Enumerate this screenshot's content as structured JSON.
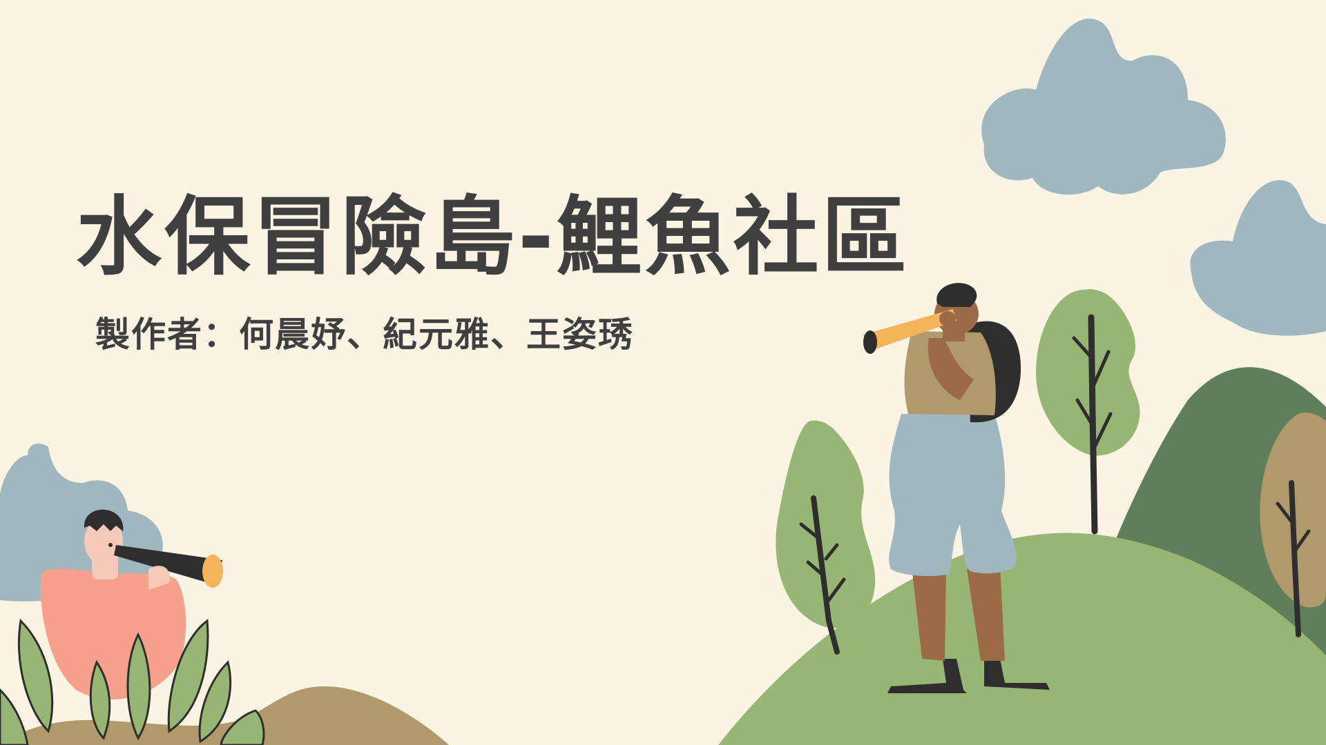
{
  "slide": {
    "title": "水保冒險島-鯉魚社區",
    "author_line": "製作者：何晨妤、紀元雅、王姿琇"
  },
  "colors": {
    "background": "#fbf4e4",
    "text": "#3f3f3f",
    "cloud": "#9fb7bf",
    "hill_light": "#98b673",
    "hill_dark": "#5f7f5a",
    "earth": "#b09a6c",
    "shirt_pink": "#f7a08c",
    "telescope_yellow": "#f4b45a"
  }
}
